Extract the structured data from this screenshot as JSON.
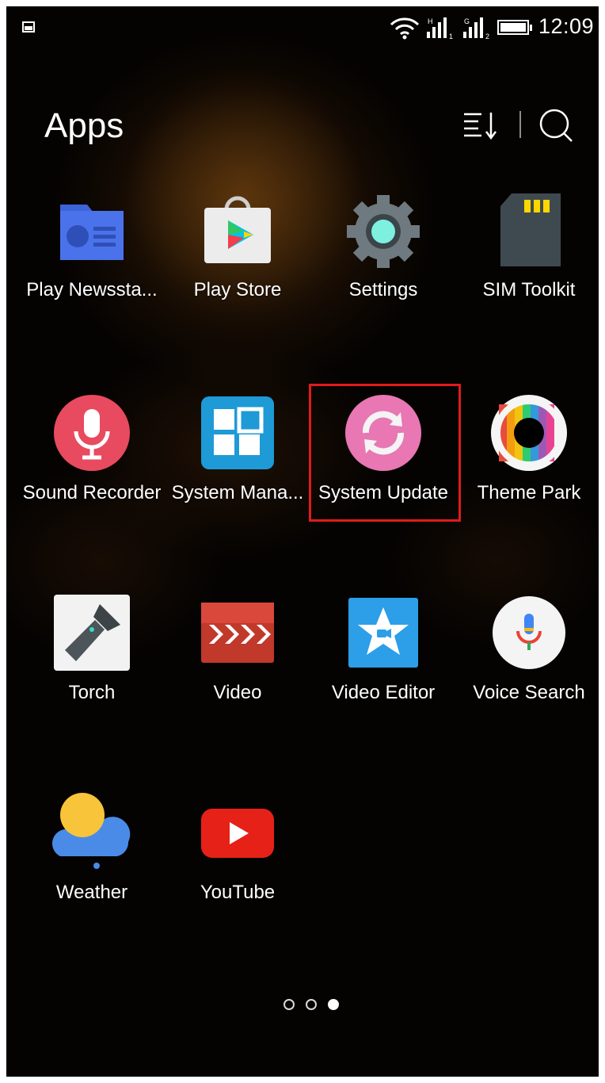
{
  "status_bar": {
    "time": "12:09",
    "sim1_tag": "H",
    "sim1_index": "1",
    "sim2_tag": "G",
    "sim2_index": "2",
    "icons": [
      "image-notification-icon",
      "wifi-icon",
      "signal-sim1-icon",
      "signal-sim2-icon",
      "battery-icon"
    ]
  },
  "header": {
    "title": "Apps",
    "actions": [
      "sort-icon",
      "search-icon"
    ]
  },
  "apps": [
    {
      "label": "Play Newssta...",
      "icon": "play-newsstand-icon"
    },
    {
      "label": "Play Store",
      "icon": "play-store-icon"
    },
    {
      "label": "Settings",
      "icon": "settings-gear-icon"
    },
    {
      "label": "SIM Toolkit",
      "icon": "sim-card-icon"
    },
    {
      "label": "Sound Recorder",
      "icon": "microphone-icon"
    },
    {
      "label": "System Mana...",
      "icon": "system-manager-icon"
    },
    {
      "label": "System Update",
      "icon": "system-update-icon"
    },
    {
      "label": "Theme Park",
      "icon": "theme-park-icon"
    },
    {
      "label": "Torch",
      "icon": "flashlight-icon"
    },
    {
      "label": "Video",
      "icon": "video-clapper-icon"
    },
    {
      "label": "Video Editor",
      "icon": "video-editor-star-icon"
    },
    {
      "label": "Voice Search",
      "icon": "voice-search-mic-icon"
    },
    {
      "label": "Weather",
      "icon": "weather-cloud-sun-icon"
    },
    {
      "label": "YouTube",
      "icon": "youtube-play-icon"
    }
  ],
  "highlighted_app": "System Update",
  "pager": {
    "pages": 3,
    "current": 3
  },
  "colors": {
    "background": "#050302",
    "highlight_border": "#e01b1b",
    "text": "#ffffff"
  }
}
